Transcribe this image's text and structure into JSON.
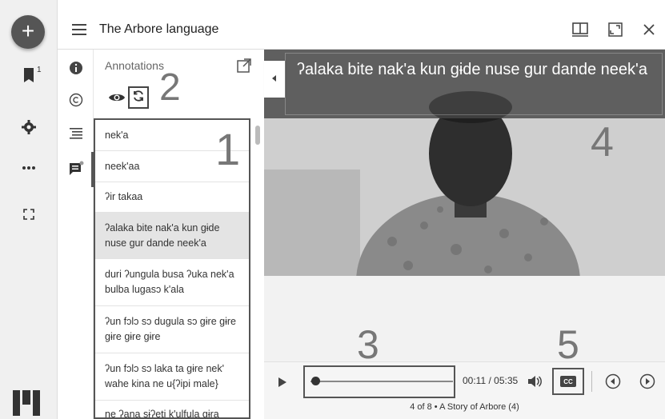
{
  "app": {
    "title": "The Arbore language"
  },
  "rail": {
    "bookmark_count": "1"
  },
  "panel": {
    "heading": "Annotations",
    "items": [
      {
        "text": "nek'a"
      },
      {
        "text": "neek'aa"
      },
      {
        "text": "ʔir takaa"
      },
      {
        "text": "ʔalaka bite nak'a kun gɨde nuse gur dande neek'a",
        "selected": true
      },
      {
        "text": "duri ʔungula busa ʔuka nek'a bulba lugasɔ k'ala"
      },
      {
        "text": "ʔun fɔlɔ sɔ dugula sɔ gɨre gɨre gɨre gɨre gɨre"
      },
      {
        "text": "ʔun fɔlɔ sɔ laka ta gɨre nek' wahe kina ne u{ʔipi male}"
      },
      {
        "text": "ne ʔana sɨʔeti k'ulfula gɨra"
      }
    ]
  },
  "callouts": {
    "c1": "1",
    "c2": "2",
    "c3": "3",
    "c4": "4",
    "c5": "5"
  },
  "video": {
    "caption": "ʔalaka bite nak'a kun gɨde nuse gur dande neek'a"
  },
  "player": {
    "current_time": "00:11",
    "duration": "05:35",
    "time_display": "00:11 / 05:35",
    "progress_fraction": 0.033,
    "cc_label": "CC"
  },
  "footer": {
    "text": "4 of 8 • A Story of Arbore (4)"
  },
  "colors": {
    "rail_bg": "#f0f0f0",
    "fab": "#555555",
    "selected_row": "#e4e4e4"
  }
}
